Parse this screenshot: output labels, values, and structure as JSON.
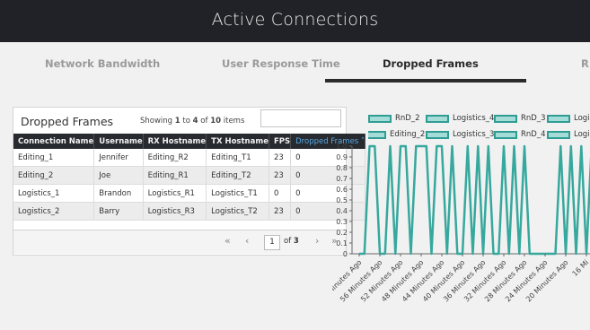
{
  "app": {
    "title": "Active Connections"
  },
  "tabs": [
    {
      "label": "Network Bandwidth"
    },
    {
      "label": "User Response Time"
    },
    {
      "label": "Dropped Frames"
    },
    {
      "label": "R"
    }
  ],
  "panel": {
    "title": "Dropped Frames",
    "showing_prefix": "Showing",
    "showing_from": "1",
    "showing_to_word": "to",
    "showing_to": "4",
    "showing_of_word": "of",
    "showing_total": "10",
    "showing_suffix": "items",
    "search_value": ""
  },
  "table": {
    "headers": [
      "Connection Name",
      "Username",
      "RX Hostname",
      "TX Hostname",
      "FPS",
      "Dropped Frames ˄"
    ],
    "rows": [
      [
        "Editing_1",
        "Jennifer",
        "Editing_R2",
        "Editing_T1",
        "23",
        "0"
      ],
      [
        "Editing_2",
        "Joe",
        "Editing_R1",
        "Editing_T2",
        "23",
        "0"
      ],
      [
        "Logistics_1",
        "Brandon",
        "Logistics_R1",
        "Logistics_T1",
        "0",
        "0"
      ],
      [
        "Logistics_2",
        "Barry",
        "Logistics_R3",
        "Logistics_T2",
        "23",
        "0"
      ]
    ]
  },
  "pager": {
    "first": "«",
    "prev": "‹",
    "page": "1",
    "of_word": "of",
    "total_pages": "3",
    "next": "›",
    "last": "»"
  },
  "chart_data": {
    "type": "line",
    "series": [
      {
        "name": "RnD_2"
      },
      {
        "name": "Logistics_4"
      },
      {
        "name": "RnD_3"
      },
      {
        "name": "Logi"
      },
      {
        "name": "Editing_2"
      },
      {
        "name": "Logistics_3"
      },
      {
        "name": "RnD_4"
      },
      {
        "name": "Logi"
      }
    ],
    "y_ticks": [
      "1.0",
      "0.9",
      "0.8",
      "0.7",
      "0.6",
      "0.5",
      "0.4",
      "0.3",
      "0.2",
      "0.1",
      "0"
    ],
    "ylim": [
      0,
      1
    ],
    "x_labels": [
      "60 Minutes Ago",
      "56 Minutes Ago",
      "52 Minutes Ago",
      "48 Minutes Ago",
      "44 Minutes Ago",
      "40 Minutes Ago",
      "36 Minutes Ago",
      "32 Minutes Ago",
      "28 Minutes Ago",
      "24 Minutes Ago",
      "20 Minutes Ago",
      "16 Mi"
    ],
    "x_minutes_ago": [
      60,
      59,
      58,
      57,
      56,
      55,
      54,
      53,
      52,
      51,
      50,
      49,
      48,
      47,
      46,
      45,
      44,
      43,
      42,
      41,
      40,
      39,
      38,
      37,
      36,
      35,
      34,
      33,
      32,
      31,
      30,
      29,
      28,
      27,
      26,
      25,
      24,
      23,
      22,
      21,
      20,
      19,
      18,
      17,
      16,
      15
    ],
    "values": [
      0,
      0,
      1,
      1,
      0,
      0,
      1,
      0,
      1,
      1,
      0,
      1,
      1,
      1,
      0,
      1,
      1,
      0,
      1,
      0,
      0,
      1,
      0,
      1,
      0,
      1,
      0,
      0,
      1,
      0,
      1,
      0,
      1,
      0,
      0,
      0,
      0,
      0,
      0,
      1,
      0,
      1,
      0,
      1,
      0,
      1
    ],
    "line_color": "#36a89d",
    "grid": false
  }
}
